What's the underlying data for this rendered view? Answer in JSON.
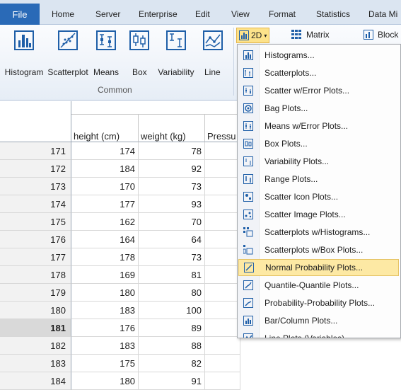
{
  "ribbon_tabs": {
    "file": "File",
    "home": "Home",
    "server": "Server",
    "enterprise": "Enterprise",
    "edit": "Edit",
    "view": "View",
    "format": "Format",
    "statistics": "Statistics",
    "datamining": "Data Mi"
  },
  "ribbon": {
    "buttons": {
      "histogram": "Histogram",
      "scatterplot": "Scatterplot",
      "means": "Means",
      "box": "Box",
      "variability": "Variability",
      "line": "Line"
    },
    "group_label": "Common",
    "btn_2d": "2D",
    "matrix": "Matrix",
    "block": "Block"
  },
  "sheet": {
    "columns": [
      "height (cm)",
      "weight (kg)",
      "Pressu"
    ],
    "rows": [
      {
        "num": "171",
        "height": "174",
        "weight": "78"
      },
      {
        "num": "172",
        "height": "184",
        "weight": "92"
      },
      {
        "num": "173",
        "height": "170",
        "weight": "73"
      },
      {
        "num": "174",
        "height": "177",
        "weight": "93"
      },
      {
        "num": "175",
        "height": "162",
        "weight": "70"
      },
      {
        "num": "176",
        "height": "164",
        "weight": "64"
      },
      {
        "num": "177",
        "height": "178",
        "weight": "73"
      },
      {
        "num": "178",
        "height": "169",
        "weight": "81"
      },
      {
        "num": "179",
        "height": "180",
        "weight": "80"
      },
      {
        "num": "180",
        "height": "183",
        "weight": "100"
      },
      {
        "num": "181",
        "height": "176",
        "weight": "89"
      },
      {
        "num": "182",
        "height": "183",
        "weight": "88"
      },
      {
        "num": "183",
        "height": "175",
        "weight": "82"
      },
      {
        "num": "184",
        "height": "180",
        "weight": "91"
      }
    ],
    "active_row": "181"
  },
  "menu": {
    "items": [
      "Histograms...",
      "Scatterplots...",
      "Scatter w/Error Plots...",
      "Bag Plots...",
      "Means w/Error Plots...",
      "Box Plots...",
      "Variability Plots...",
      "Range Plots...",
      "Scatter Icon Plots...",
      "Scatter Image Plots...",
      "Scatterplots w/Histograms...",
      "Scatterplots w/Box Plots...",
      "Normal Probability Plots...",
      "Quantile-Quantile Plots...",
      "Probability-Probability Plots...",
      "Bar/Column Plots...",
      "Line Plots (Variables)..."
    ],
    "highlighted_index": 12
  },
  "colors": {
    "file_tab": "#2a6ab7",
    "tabbar": "#dbe5f1",
    "highlight": "#fde9a4",
    "icon_blue": "#1f5fa8"
  }
}
